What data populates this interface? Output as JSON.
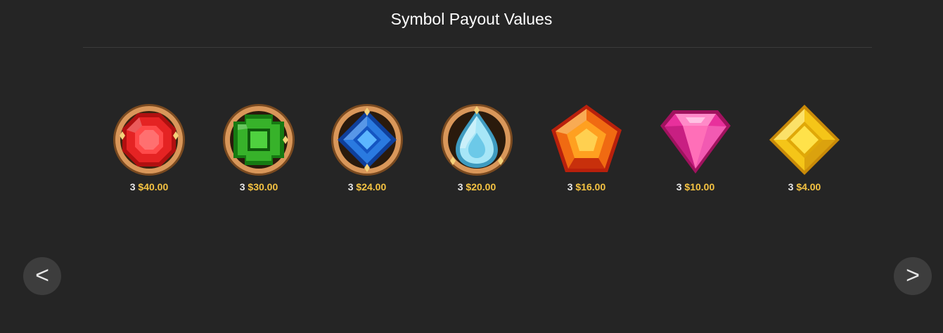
{
  "header": {
    "title": "Symbol Payout Values"
  },
  "symbols": [
    {
      "icon": "red-octagon-gem-icon",
      "count": "3",
      "value": "$40.00",
      "color": "#d81f1f"
    },
    {
      "icon": "green-emerald-gem-icon",
      "count": "3",
      "value": "$30.00",
      "color": "#2eaa22"
    },
    {
      "icon": "blue-sapphire-gem-icon",
      "count": "3",
      "value": "$24.00",
      "color": "#1f6fd6"
    },
    {
      "icon": "light-blue-teardrop-gem-icon",
      "count": "3",
      "value": "$20.00",
      "color": "#8fd8ee"
    },
    {
      "icon": "orange-pentagon-gem-icon",
      "count": "3",
      "value": "$16.00",
      "color": "#f07d10"
    },
    {
      "icon": "pink-diamond-gem-icon",
      "count": "3",
      "value": "$10.00",
      "color": "#e8309c"
    },
    {
      "icon": "yellow-rhombus-gem-icon",
      "count": "3",
      "value": "$4.00",
      "color": "#f5c518"
    }
  ],
  "nav": {
    "prev_label": "<",
    "next_label": ">"
  },
  "colors": {
    "background": "#252525",
    "payout_value": "#f5c342",
    "medallion_rim": "#c98a4a"
  }
}
